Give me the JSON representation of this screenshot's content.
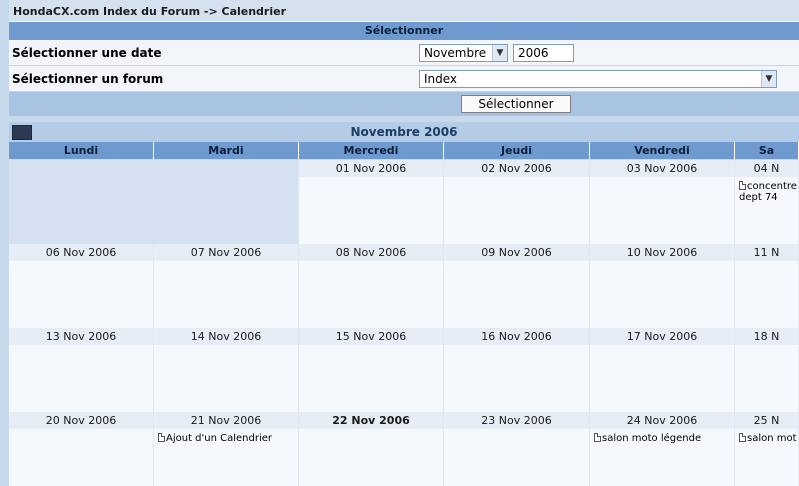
{
  "breadcrumb": "HondaCX.com Index du Forum -> Calendrier",
  "selection": {
    "header": "Sélectionner",
    "date_label": "Sélectionner une date",
    "month_value": "Novembre",
    "year_value": "2006",
    "forum_label": "Sélectionner un forum",
    "forum_value": "Index",
    "submit_label": "Sélectionner"
  },
  "calendar": {
    "month_title": "Novembre 2006",
    "days": [
      "Lundi",
      "Mardi",
      "Mercredi",
      "Jeudi",
      "Vendredi",
      "Sa"
    ],
    "weeks": [
      [
        "",
        "",
        "01 Nov 2006",
        "02 Nov 2006",
        "03 Nov 2006",
        "04 N"
      ],
      [
        "06 Nov 2006",
        "07 Nov 2006",
        "08 Nov 2006",
        "09 Nov 2006",
        "10 Nov 2006",
        "11 N"
      ],
      [
        "13 Nov 2006",
        "14 Nov 2006",
        "15 Nov 2006",
        "16 Nov 2006",
        "17 Nov 2006",
        "18 N"
      ],
      [
        "20 Nov 2006",
        "21 Nov 2006",
        "22 Nov 2006",
        "23 Nov 2006",
        "24 Nov 2006",
        "25 N"
      ]
    ],
    "events": {
      "w0d5": [
        "concentre",
        "dept 74"
      ],
      "w3d1": "Ajout d'un Calendrier",
      "w3d4": "salon moto légende",
      "w3d5": "salon mot"
    }
  },
  "colors": {
    "header_blue": "#6f9ad0",
    "cell_bg": "#f5f8fc",
    "empty_cell": "#d3e0ef"
  }
}
